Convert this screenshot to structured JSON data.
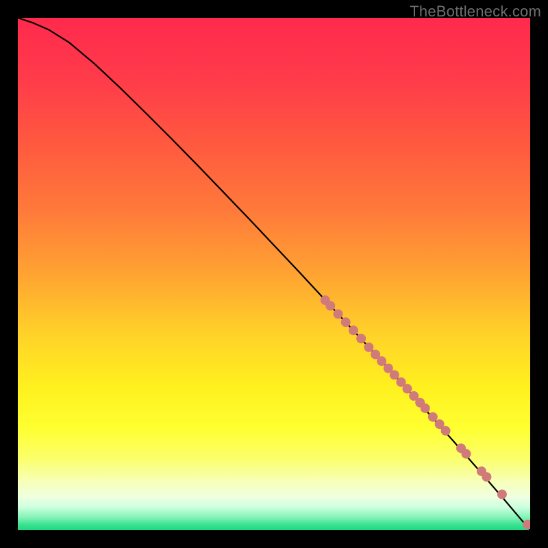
{
  "watermark": "TheBottleneck.com",
  "colors": {
    "curve_stroke": "#000000",
    "dot_fill": "#d17a7a",
    "gradient_stops": [
      {
        "offset": 0.0,
        "color": "#ff2a4d"
      },
      {
        "offset": 0.12,
        "color": "#ff3b4a"
      },
      {
        "offset": 0.25,
        "color": "#ff5a3f"
      },
      {
        "offset": 0.38,
        "color": "#ff7b3a"
      },
      {
        "offset": 0.5,
        "color": "#ffa332"
      },
      {
        "offset": 0.62,
        "color": "#ffd328"
      },
      {
        "offset": 0.72,
        "color": "#fff01f"
      },
      {
        "offset": 0.8,
        "color": "#ffff30"
      },
      {
        "offset": 0.86,
        "color": "#fbff6a"
      },
      {
        "offset": 0.905,
        "color": "#f7ffb8"
      },
      {
        "offset": 0.935,
        "color": "#efffe0"
      },
      {
        "offset": 0.955,
        "color": "#ccffdf"
      },
      {
        "offset": 0.975,
        "color": "#84f3b8"
      },
      {
        "offset": 0.99,
        "color": "#36e08e"
      },
      {
        "offset": 1.0,
        "color": "#1fd884"
      }
    ]
  },
  "chart_data": {
    "type": "line",
    "title": "",
    "xlabel": "",
    "ylabel": "",
    "xlim": [
      0,
      100
    ],
    "ylim": [
      0,
      100
    ],
    "series": [
      {
        "name": "curve",
        "x": [
          0,
          3,
          6,
          10,
          15,
          20,
          25,
          30,
          35,
          40,
          45,
          50,
          55,
          60,
          65,
          70,
          75,
          80,
          85,
          90,
          95,
          100
        ],
        "y": [
          100,
          99,
          97.7,
          95.2,
          91,
          86.3,
          81.4,
          76.4,
          71.3,
          66.1,
          60.9,
          55.6,
          50.3,
          44.9,
          39.5,
          34.1,
          28.6,
          23.0,
          17.4,
          11.7,
          5.9,
          0
        ]
      }
    ],
    "dots": {
      "name": "highlight-points",
      "x": [
        60,
        61,
        62.5,
        64,
        65.5,
        67,
        68.5,
        69.8,
        71,
        72.3,
        73.5,
        74.8,
        76,
        77.3,
        78.5,
        79.5,
        81,
        82.3,
        83.5,
        86.5,
        87.5,
        90.5,
        91.5,
        94.5,
        99.5
      ],
      "y": [
        44.9,
        43.8,
        42.2,
        40.6,
        39.0,
        37.4,
        35.7,
        34.3,
        33.0,
        31.6,
        30.3,
        28.9,
        27.6,
        26.2,
        24.9,
        23.8,
        22.1,
        20.7,
        19.4,
        16.0,
        14.9,
        11.5,
        10.4,
        7.0,
        1.1
      ]
    }
  }
}
